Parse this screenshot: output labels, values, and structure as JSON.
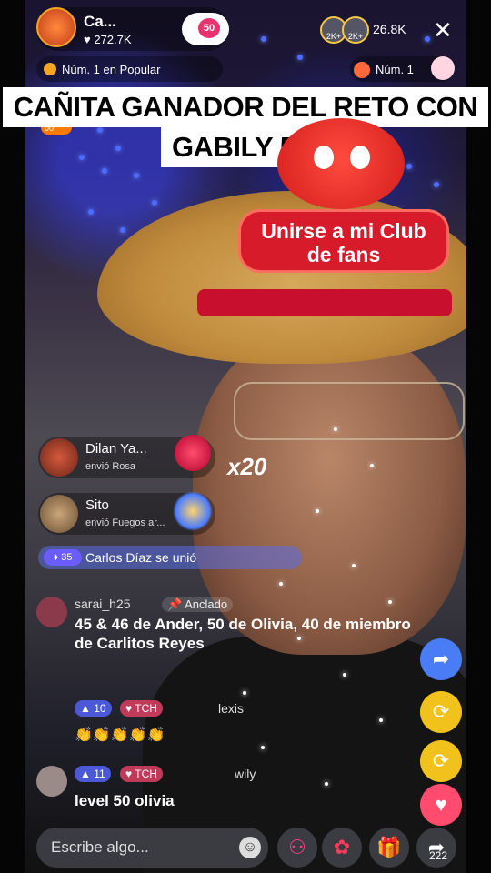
{
  "host": {
    "name": "Ca...",
    "likes": "272.7K",
    "fanclub_level": "50"
  },
  "viewers": {
    "avatar_labels": [
      "2K+",
      "2K+"
    ],
    "count": "26.8K"
  },
  "ranks": {
    "popular": "Núm. 1 en Popular",
    "secondary": "Núm. 1"
  },
  "title": {
    "line1": "CAÑITA GANADOR DEL RETO CON",
    "line2": "GABILY 5-3"
  },
  "timer": "00:",
  "fan_club_banner": {
    "line1": "Unirse a mi Club",
    "line2": "de fans"
  },
  "gifts": [
    {
      "name": "Dilan Ya...",
      "action": "envió Rosa",
      "combo": "x20"
    },
    {
      "name": "Sito",
      "action": "envió Fuegos ar..."
    }
  ],
  "join": {
    "badge": "35",
    "text": "Carlos Díaz se unió"
  },
  "comments": [
    {
      "user": "sarai_h25",
      "pinned_label": "Anclado",
      "text": "45 & 46 de Ander, 50 de Olivia, 40 de miembro de Carlitos Reyes"
    },
    {
      "level": "10",
      "team": "TCH",
      "user": "lexis",
      "text": "👏👏👏👏👏"
    },
    {
      "level": "11",
      "team": "TCH",
      "user": "wily",
      "text": "level 50 olivia"
    }
  ],
  "bottom_bar": {
    "comment_placeholder": "Escribe algo...",
    "share_count": "222"
  }
}
